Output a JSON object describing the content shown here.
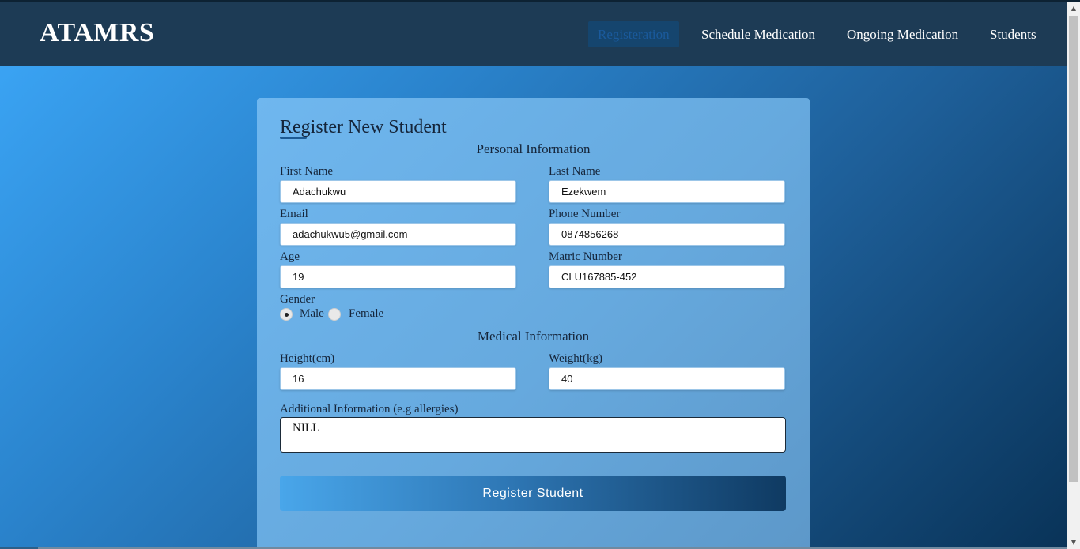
{
  "brand": "ATAMRS",
  "nav": {
    "registration": "Registeration",
    "schedule": "Schedule Medication",
    "ongoing": "Ongoing Medication",
    "students": "Students"
  },
  "form": {
    "title": "Register New Student",
    "personal_section": "Personal Information",
    "medical_section": "Medical Information",
    "first_name": {
      "label": "First Name",
      "value": "Adachukwu"
    },
    "last_name": {
      "label": "Last Name",
      "value": "Ezekwem"
    },
    "email": {
      "label": "Email",
      "value": "adachukwu5@gmail.com"
    },
    "phone": {
      "label": "Phone Number",
      "value": "0874856268"
    },
    "age": {
      "label": "Age",
      "value": "19"
    },
    "matric": {
      "label": "Matric Number",
      "value": "CLU167885-452"
    },
    "gender": {
      "label": "Gender",
      "options": [
        "Male",
        "Female"
      ],
      "selected": "Male"
    },
    "height": {
      "label": "Height(cm)",
      "value": "16"
    },
    "weight": {
      "label": "Weight(kg)",
      "value": "40"
    },
    "additional": {
      "label": "Additional Information (e.g allergies)",
      "value": "NILL"
    },
    "submit_label": "Register Student"
  },
  "scrollbar": {
    "up_glyph": "▲",
    "down_glyph": "▼"
  },
  "colors": {
    "navbar": "#1d3b55",
    "active_nav_bg": "#15456e",
    "card": "#66a9de",
    "button_start": "#49a6ea",
    "button_end": "#0f3a62"
  }
}
